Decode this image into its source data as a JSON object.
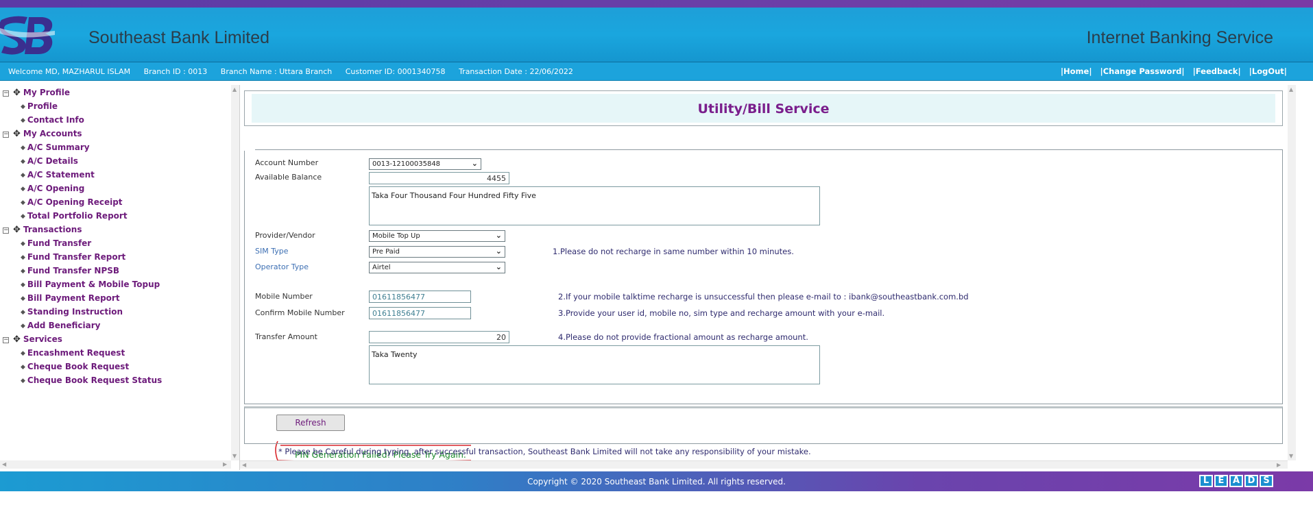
{
  "header": {
    "bank_name": "Southeast Bank Limited",
    "service_name": "Internet Banking Service",
    "logo_text": "SB"
  },
  "infobar": {
    "welcome": "Welcome MD, MAZHARUL ISLAM",
    "branch_id": "Branch ID : 0013",
    "branch_name": "Branch Name : Uttara Branch",
    "customer_id": "Customer ID: 0001340758",
    "transaction_date": "Transaction Date : 22/06/2022",
    "links": [
      "|Home|",
      "|Change Password|",
      "|Feedback|",
      "|LogOut|"
    ]
  },
  "sidebar": {
    "groups": [
      {
        "label": "My Profile",
        "items": [
          "Profile",
          "Contact Info"
        ]
      },
      {
        "label": "My Accounts",
        "items": [
          "A/C Summary",
          "A/C Details",
          "A/C Statement",
          "A/C Opening",
          "A/C Opening Receipt",
          "Total Portfolio Report"
        ]
      },
      {
        "label": "Transactions",
        "items": [
          "Fund Transfer",
          "Fund Transfer Report",
          "Fund Transfer NPSB",
          "Bill Payment & Mobile Topup",
          "Bill Payment Report",
          "Standing Instruction",
          "Add Beneficiary"
        ]
      },
      {
        "label": "Services",
        "items": [
          "Encashment Request",
          "Cheque Book Request",
          "Cheque Book Request Status"
        ]
      }
    ]
  },
  "main": {
    "title": "Utility/Bill Service",
    "form": {
      "account_number_label": "Account Number",
      "account_number_value": "0013-12100035848",
      "available_balance_label": "Available Balance",
      "available_balance_value": "4455",
      "balance_words": "Taka Four Thousand Four Hundred Fifty Five",
      "provider_label": "Provider/Vendor",
      "provider_value": "Mobile Top Up",
      "sim_type_label": "SIM Type",
      "sim_type_value": "Pre Paid",
      "operator_label": "Operator Type",
      "operator_value": "Airtel",
      "mobile_label": "Mobile Number",
      "mobile_value": "01611856477",
      "confirm_mobile_label": "Confirm Mobile Number",
      "confirm_mobile_value": "01611856477",
      "transfer_amount_label": "Transfer Amount",
      "transfer_amount_value": "20",
      "amount_words": "Taka Twenty"
    },
    "notes": [
      "1.Please do not recharge in same number within 10 minutes.",
      "2.If your mobile talktime recharge is unsuccessful then please e-mail to : ibank@southeastbank.com.bd",
      "3.Provide your user id, mobile no, sim type and recharge amount with your e-mail.",
      "4.Please do not provide fractional amount as recharge amount."
    ],
    "error_message": "PIN Generation Failed! Please Try Again.",
    "refresh_label": "Refresh",
    "disclaimer": "* Please be Careful during typing, after successful transaction, Southeast Bank Limited will not take any responsibility of your mistake."
  },
  "footer": {
    "copyright": "Copyright © 2020 Southeast Bank Limited. All rights reserved.",
    "vendor_logo_letters": [
      "L",
      "E",
      "A",
      "D",
      "S"
    ]
  },
  "colors": {
    "header_blue": "#1aa6de",
    "menu_purple": "#6d1b7b",
    "title_purple": "#7a1e8c",
    "error_green": "#1d8a2c",
    "annotation_red": "#d9262c"
  }
}
